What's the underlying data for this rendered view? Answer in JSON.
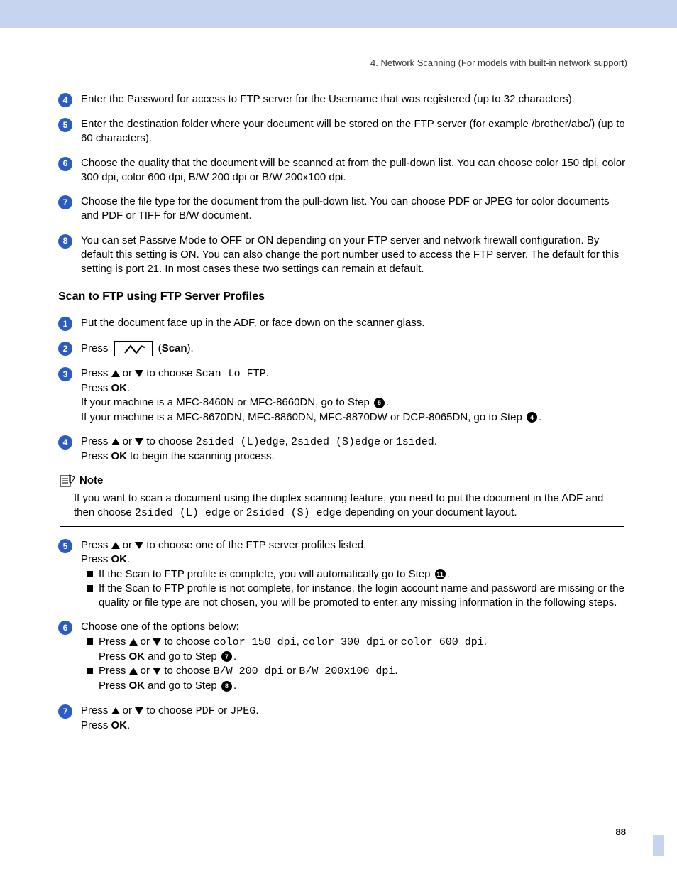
{
  "header": "4. Network Scanning (For models with  built-in network support)",
  "page_number": "88",
  "section1": {
    "step4": "Enter the Password for access to FTP server for the Username that was registered (up to 32 characters).",
    "step5": "Enter the destination folder where your document will be stored on the FTP server (for example /brother/abc/) (up to 60 characters).",
    "step6": "Choose the quality that the document will be scanned at from the pull-down list. You can choose color 150 dpi, color 300 dpi, color 600 dpi, B/W 200 dpi or B/W 200x100 dpi.",
    "step7": "Choose the file type for the document from the pull-down list. You can choose PDF or JPEG for color documents and PDF or TIFF for B/W document.",
    "step8": "You can set Passive Mode to OFF or ON depending on your FTP server and network firewall configuration. By default this setting is ON. You can also change the port number used to access the FTP server. The default for this setting is port 21. In most cases these two settings can remain at default."
  },
  "section2": {
    "heading": "Scan to FTP using FTP Server Profiles",
    "step1": "Put the document face up in the ADF, or face down on the scanner glass.",
    "step2_press": "Press",
    "step2_scan": "Scan",
    "step3_press": "Press ",
    "step3_or": " or ",
    "step3_choose": " to choose ",
    "step3_code": "Scan to FTP",
    "step3_dot": ".",
    "step3_pressok": "Press ",
    "step3_ok": "OK",
    "step3_line3": "If your machine is a MFC-8460N or MFC-8660DN, go to Step ",
    "step3_line4": "If your machine is a MFC-8670DN, MFC-8860DN, MFC-8870DW or DCP-8065DN, go to Step ",
    "step4_press": "Press ",
    "step4_or": " or ",
    "step4_choose": " to choose ",
    "step4_code1": "2sided (L)edge",
    "step4_comma": ", ",
    "step4_code2": "2sided (S)edge",
    "step4_or2": " or ",
    "step4_code3": "1sided",
    "step4_dot": ".",
    "step4_pressok": "Press ",
    "step4_ok": "OK",
    "step4_rest": " to begin the scanning process.",
    "note_label": "Note",
    "note_p1a": "If you want to scan a document using the duplex scanning feature, you need to put the document in the ADF and then choose ",
    "note_code1": "2sided (L) edge",
    "note_or": " or ",
    "note_code2": "2sided (S) edge",
    "note_p1b": " depending on your document layout.",
    "step5_press": "Press ",
    "step5_or": " or ",
    "step5_choose": " to choose one of the FTP server profiles listed.",
    "step5_pressok": "Press ",
    "step5_ok": "OK",
    "step5_b1": "If the Scan to FTP profile is complete, you will automatically go to Step ",
    "step5_b2": "If the Scan to FTP profile is not complete, for instance, the login account name and password are missing or the quality or file type are not chosen, you will be promoted to enter any missing information in the following steps.",
    "step6_intro": "Choose one of the options below:",
    "step6_b1_press": "Press ",
    "step6_b1_or": " or ",
    "step6_b1_choose": " to choose ",
    "step6_b1_c1": "color 150 dpi",
    "step6_b1_comma": ", ",
    "step6_b1_c2": "color 300 dpi",
    "step6_b1_or2": " or ",
    "step6_b1_c3": "color 600 dpi",
    "step6_b1_dot": ".",
    "step6_b1_press2": "Press ",
    "step6_b1_ok": "OK",
    "step6_b1_go": " and go to Step ",
    "step6_b2_press": "Press ",
    "step6_b2_or": " or ",
    "step6_b2_choose": " to choose ",
    "step6_b2_c1": "B/W 200 dpi",
    "step6_b2_or2": " or ",
    "step6_b2_c2": "B/W 200x100 dpi",
    "step6_b2_dot": ".",
    "step6_b2_press2": "Press ",
    "step6_b2_ok": "OK",
    "step6_b2_go": " and go to Step ",
    "step7_press": "Press ",
    "step7_or": " or ",
    "step7_choose": " to choose ",
    "step7_c1": "PDF",
    "step7_or2": " or ",
    "step7_c2": "JPEG",
    "step7_dot": ".",
    "step7_pressok": "Press ",
    "step7_ok": "OK",
    "ref_5": "e",
    "ref_4": "d",
    "ref_11": "k",
    "ref_7": "g",
    "ref_8": "h"
  }
}
